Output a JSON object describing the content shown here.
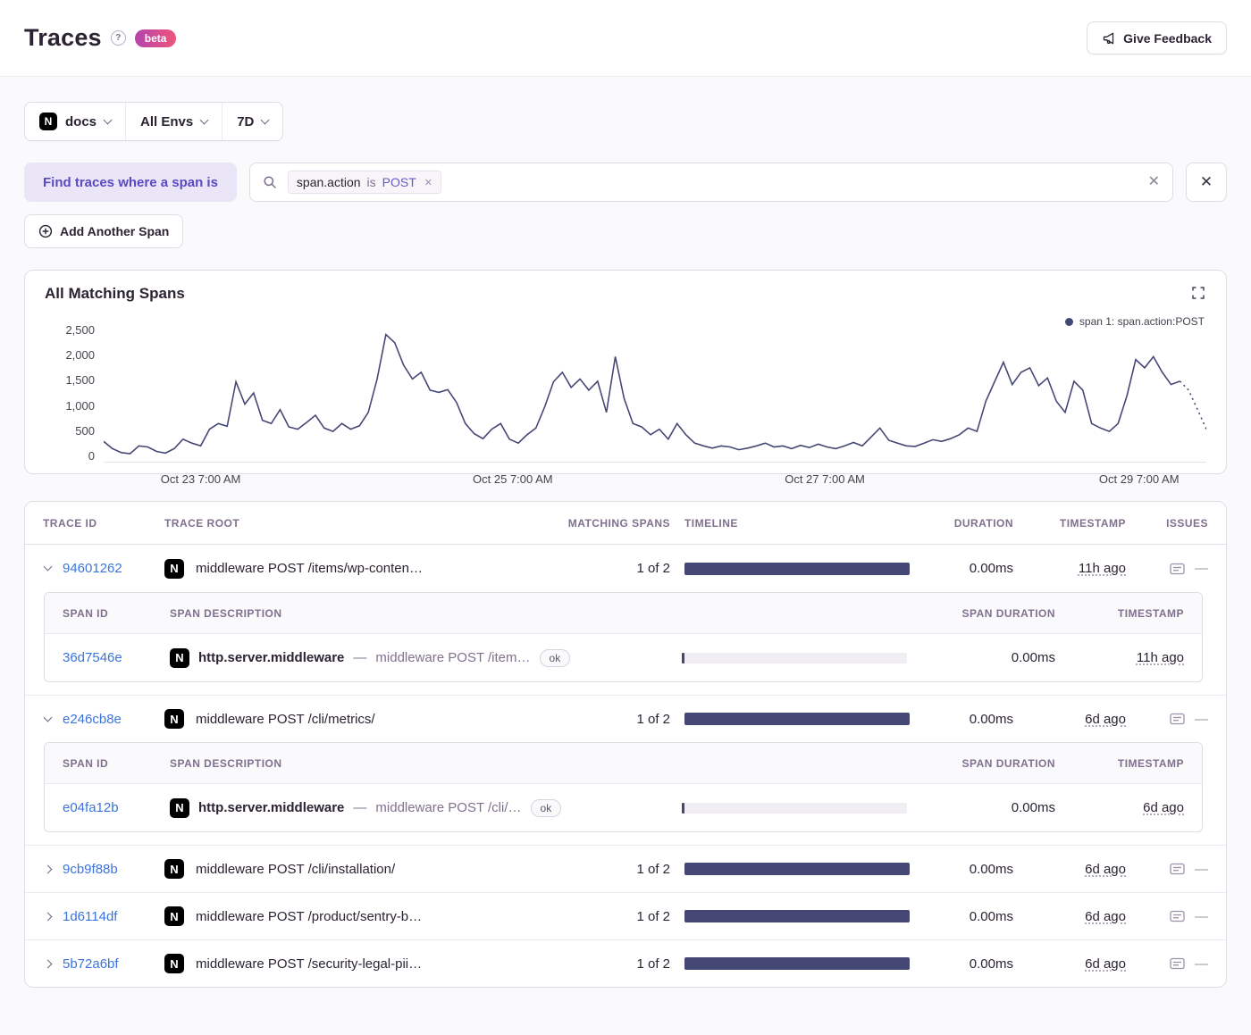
{
  "page": {
    "title": "Traces",
    "beta_badge": "beta",
    "feedback_button": "Give Feedback"
  },
  "filters": {
    "project": "docs",
    "environment": "All Envs",
    "period": "7D"
  },
  "icons": {
    "project_logo_letter": "N"
  },
  "span_filter": {
    "where_label": "Find traces where a span is",
    "token": {
      "key": "span.action",
      "op": "is",
      "value": "POST"
    },
    "add_span_button": "Add Another Span"
  },
  "chart": {
    "title": "All Matching Spans",
    "legend": "span 1: span.action:POST",
    "y_ticks": [
      "2,500",
      "2,000",
      "1,500",
      "1,000",
      "500",
      "0"
    ],
    "x_ticks": [
      "Oct 23 7:00 AM",
      "Oct 25 7:00 AM",
      "Oct 27 7:00 AM",
      "Oct 29 7:00 AM"
    ]
  },
  "chart_data": {
    "type": "line",
    "title": "All Matching Spans",
    "ylim": [
      0,
      2500
    ],
    "y_tick_values": [
      0,
      500,
      1000,
      1500,
      2000,
      2500
    ],
    "x_tick_labels": [
      "Oct 23 7:00 AM",
      "Oct 25 7:00 AM",
      "Oct 27 7:00 AM",
      "Oct 29 7:00 AM"
    ],
    "x_tick_positions": [
      0.088,
      0.371,
      0.654,
      0.939
    ],
    "grid": false,
    "legend_position": "top-right",
    "line_color": "#444674",
    "dashed_tail_points": 4,
    "series": [
      {
        "name": "span 1: span.action:POST",
        "values": [
          380,
          250,
          180,
          160,
          300,
          280,
          200,
          170,
          250,
          420,
          350,
          300,
          600,
          700,
          650,
          1450,
          1050,
          1250,
          760,
          700,
          950,
          640,
          600,
          720,
          850,
          620,
          560,
          700,
          600,
          660,
          900,
          1500,
          2300,
          2150,
          1750,
          1500,
          1620,
          1300,
          1260,
          1310,
          1080,
          700,
          520,
          430,
          600,
          700,
          420,
          350,
          500,
          620,
          1000,
          1450,
          1620,
          1350,
          1500,
          1300,
          1460,
          900,
          1900,
          1150,
          700,
          640,
          500,
          600,
          420,
          700,
          500,
          350,
          300,
          260,
          300,
          280,
          230,
          260,
          300,
          350,
          280,
          300,
          250,
          310,
          270,
          330,
          280,
          250,
          300,
          360,
          300,
          460,
          620,
          400,
          350,
          300,
          290,
          350,
          410,
          380,
          430,
          500,
          620,
          560,
          1100,
          1450,
          1800,
          1400,
          1620,
          1700,
          1380,
          1520,
          1100,
          900,
          1460,
          1300,
          700,
          620,
          560,
          700,
          1200,
          1850,
          1700,
          1900,
          1620,
          1400,
          1460,
          1300,
          950,
          600
        ]
      }
    ]
  },
  "table": {
    "headers": {
      "trace_id": "Trace ID",
      "trace_root": "Trace Root",
      "matching_spans": "Matching Spans",
      "timeline": "Timeline",
      "duration": "Duration",
      "timestamp": "Timestamp",
      "issues": "Issues"
    },
    "span_headers": {
      "span_id": "Span ID",
      "span_description": "Span Description",
      "span_duration": "Span Duration",
      "timestamp": "Timestamp"
    },
    "separator": "—",
    "issues_empty": "—",
    "rows": [
      {
        "trace_id": "94601262",
        "expanded": true,
        "root": "middleware POST /items/wp-conten…",
        "matching": "1 of 2",
        "duration": "0.00ms",
        "timestamp": "11h ago",
        "spans": [
          {
            "span_id": "36d7546e",
            "op": "http.server.middleware",
            "description": "middleware POST /item…",
            "status": "ok",
            "duration": "0.00ms",
            "timestamp": "11h ago"
          }
        ]
      },
      {
        "trace_id": "e246cb8e",
        "expanded": true,
        "root": "middleware POST /cli/metrics/",
        "matching": "1 of 2",
        "duration": "0.00ms",
        "timestamp": "6d ago",
        "spans": [
          {
            "span_id": "e04fa12b",
            "op": "http.server.middleware",
            "description": "middleware POST /cli/…",
            "status": "ok",
            "duration": "0.00ms",
            "timestamp": "6d ago"
          }
        ]
      },
      {
        "trace_id": "9cb9f88b",
        "expanded": false,
        "root": "middleware POST /cli/installation/",
        "matching": "1 of 2",
        "duration": "0.00ms",
        "timestamp": "6d ago",
        "spans": []
      },
      {
        "trace_id": "1d6114df",
        "expanded": false,
        "root": "middleware POST /product/sentry-b…",
        "matching": "1 of 2",
        "duration": "0.00ms",
        "timestamp": "6d ago",
        "spans": []
      },
      {
        "trace_id": "5b72a6bf",
        "expanded": false,
        "root": "middleware POST /security-legal-pii…",
        "matching": "1 of 2",
        "duration": "0.00ms",
        "timestamp": "6d ago",
        "spans": []
      }
    ]
  },
  "colors": {
    "accent": "#444674",
    "link": "#3c74dd",
    "purple": "#584ac0"
  }
}
